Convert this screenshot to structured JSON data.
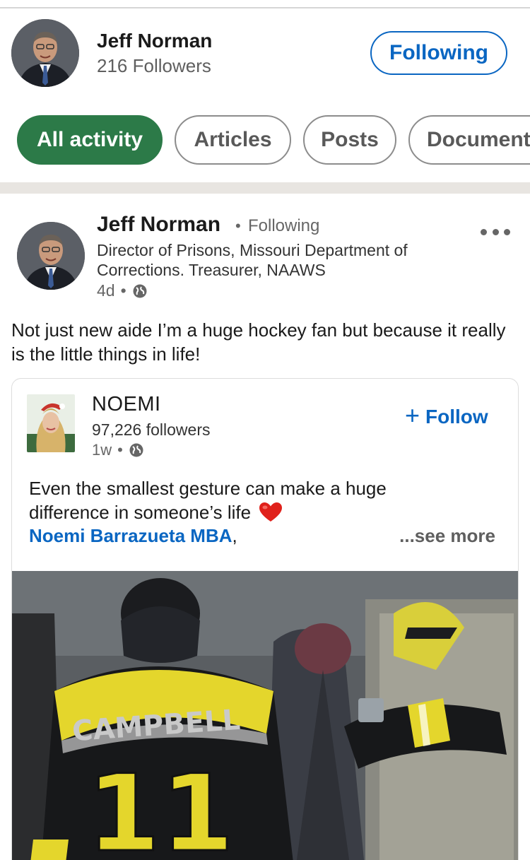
{
  "profile": {
    "name": "Jeff Norman",
    "followers": "216 Followers",
    "following_label": "Following"
  },
  "filters": [
    {
      "label": "All activity",
      "active": true
    },
    {
      "label": "Articles",
      "active": false
    },
    {
      "label": "Posts",
      "active": false
    },
    {
      "label": "Documents",
      "active": false
    }
  ],
  "post": {
    "author": "Jeff Norman",
    "separator": "•",
    "relation": "Following",
    "headline": "Director of Prisons, Missouri Department of Corrections. Treasurer, NAAWS",
    "age": "4d",
    "meta_separator": "•",
    "visibility_icon": "globe-icon",
    "menu_icon": "more-horizontal-icon",
    "text": "Not just new aide I’m a huge hockey fan but because it really is the little things in life!"
  },
  "shared": {
    "author": "NOEMI",
    "followers": "97,226 followers",
    "age": "1w",
    "meta_separator": "•",
    "follow_label": "Follow",
    "follow_icon": "plus-icon",
    "text": "Even the smallest gesture can make a huge difference in someone’s life",
    "emoji_icon": "heart-icon",
    "mention": "Noemi Barrazueta MBA",
    "mention_suffix": ",",
    "see_more": "...see more",
    "video": {
      "jersey_name": "CAMPBELL",
      "jersey_number": "11"
    }
  },
  "colors": {
    "accent": "#0a66c2",
    "active_chip": "#2c7a48",
    "divider": "#e8e5e1"
  }
}
